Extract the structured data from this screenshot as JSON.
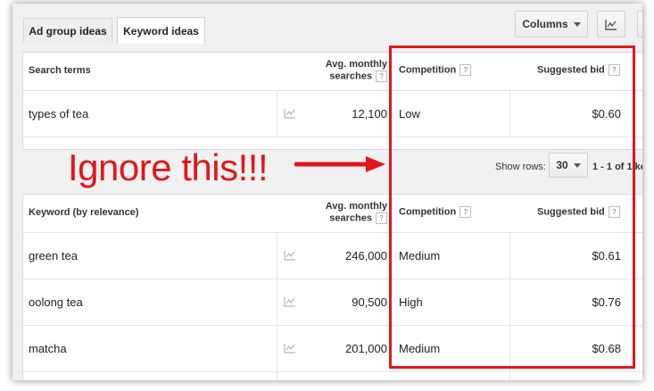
{
  "tabs": [
    {
      "label": "Ad group ideas",
      "active": false
    },
    {
      "label": "Keyword ideas",
      "active": true
    }
  ],
  "toolbar": {
    "columns_label": "Columns",
    "chart_icon": "line-chart-icon"
  },
  "search_terms_table": {
    "headers": {
      "term": "Search terms",
      "searches_line1": "Avg. monthly",
      "searches_line2": "searches",
      "competition": "Competition",
      "bid": "Suggested bid",
      "help_glyph": "?"
    },
    "rows": [
      {
        "term": "types of tea",
        "searches": "12,100",
        "competition": "Low",
        "bid": "$0.60"
      }
    ]
  },
  "pagination": {
    "show_rows_label": "Show rows:",
    "rows_value": "30",
    "range_text": "1 - 1 of 1 ke"
  },
  "keyword_table": {
    "headers": {
      "keyword": "Keyword (by relevance)",
      "searches_line1": "Avg. monthly",
      "searches_line2": "searches",
      "competition": "Competition",
      "bid": "Suggested bid",
      "help_glyph": "?"
    },
    "rows": [
      {
        "keyword": "green tea",
        "searches": "246,000",
        "competition": "Medium",
        "bid": "$0.61"
      },
      {
        "keyword": "oolong tea",
        "searches": "90,500",
        "competition": "High",
        "bid": "$0.76"
      },
      {
        "keyword": "matcha",
        "searches": "201,000",
        "competition": "Medium",
        "bid": "$0.68"
      }
    ]
  },
  "annotation": {
    "text": "Ignore this!!!",
    "color": "#e0171b"
  },
  "colors": {
    "accent_red": "#e0171b",
    "frame_bg": "#f1f1f1",
    "trend_icon": "#b5b5b5"
  }
}
